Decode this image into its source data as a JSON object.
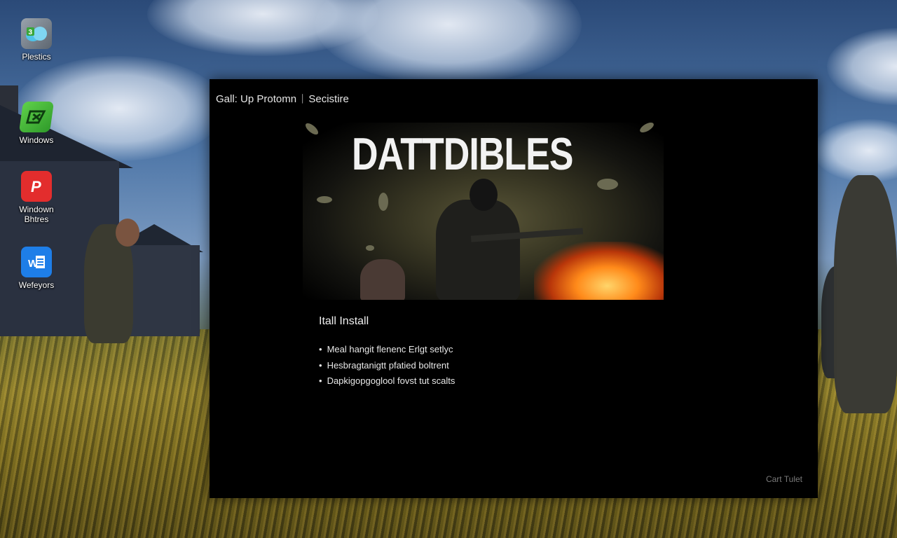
{
  "desktop": {
    "icons": [
      {
        "label": "Plestics",
        "badge": "3"
      },
      {
        "label": "Windows"
      },
      {
        "label": "Windown\nBhtres",
        "badge": "P"
      },
      {
        "label": "Wefeyors",
        "badge": "W"
      }
    ]
  },
  "installer": {
    "title": "Gall: Up Protomn ᛁ Secistire",
    "banner_logo": "DATTDIBLES",
    "section_title": "Itall Install",
    "features": [
      "Meal hangit flenenc Erlgt setlyc",
      "Hesbragtanigtt pfatied boltrent",
      "Dapkigopgoglool fovst tut scalts"
    ],
    "footer_button": "Cart Tulet"
  },
  "colors": {
    "window_bg": "#000000",
    "icon_red": "#e32d2d",
    "icon_blue": "#1e7ee8",
    "icon_green": "#3fb83a"
  }
}
